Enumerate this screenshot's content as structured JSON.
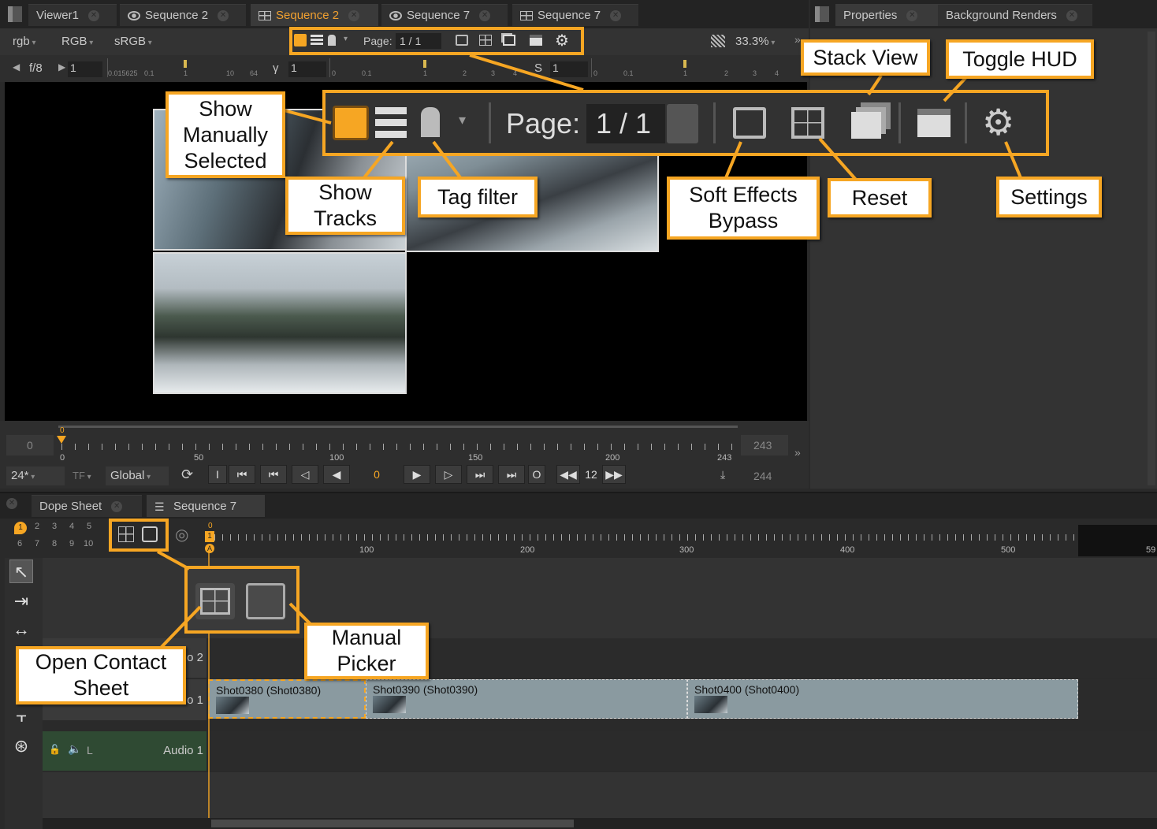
{
  "viewer_tabs": [
    {
      "label": "Viewer1",
      "icon": "",
      "active": false
    },
    {
      "label": "Sequence 2",
      "icon": "eye-icon",
      "active": false
    },
    {
      "label": "Sequence 2",
      "icon": "contact-sheet-icon",
      "active": true
    },
    {
      "label": "Sequence 7",
      "icon": "eye-icon",
      "active": false
    },
    {
      "label": "Sequence 7",
      "icon": "contact-sheet-icon",
      "active": false
    }
  ],
  "right_tabs": [
    {
      "label": "Properties"
    },
    {
      "label": "Background Renders"
    }
  ],
  "viewer_toolbar": {
    "channels": "rgb",
    "colorspace_a": "RGB",
    "colorspace_b": "sRGB",
    "page_label": "Page:",
    "page_value": "1 / 1",
    "zoom": "33.3%"
  },
  "exposure_bar": {
    "fstop": "f/8",
    "gain_value": "1",
    "gain_ticks": [
      "0.015625",
      "0.1",
      "1",
      "10",
      "64"
    ],
    "gamma_label": "γ",
    "gamma_value": "1",
    "gamma_ticks": [
      "0",
      "0.1",
      "1",
      "2",
      "3",
      "4"
    ],
    "sat_label": "S",
    "sat_value": "1",
    "sat_ticks": [
      "0",
      "0.1",
      "1",
      "2",
      "3",
      "4"
    ]
  },
  "callouts": {
    "show_manually_selected": "Show Manually Selected",
    "show_tracks": "Show Tracks",
    "tag_filter": "Tag filter",
    "stack_view": "Stack View",
    "toggle_hud": "Toggle HUD",
    "soft_effects_bypass": "Soft Effects Bypass",
    "reset": "Reset",
    "settings": "Settings",
    "open_contact_sheet": "Open Contact Sheet",
    "manual_picker": "Manual Picker"
  },
  "zoomed_toolbar": {
    "page_label": "Page:",
    "page_value": "1 / 1"
  },
  "timeline": {
    "start": "0",
    "in_marker": "0",
    "ticks": [
      "0",
      "50",
      "100",
      "150",
      "200",
      "243"
    ],
    "end_top": "243",
    "end_bottom": "244",
    "fps": "24*",
    "tf": "TF",
    "scope": "Global",
    "in_btn": "I",
    "out_btn": "O",
    "current_frame": "0",
    "step": "12"
  },
  "bottom_tabs": [
    {
      "label": "Dope Sheet"
    },
    {
      "label": "Sequence 7"
    }
  ],
  "layer_numbers_top": [
    "1",
    "2",
    "3",
    "4",
    "5"
  ],
  "layer_numbers_bottom": [
    "6",
    "7",
    "8",
    "9",
    "10"
  ],
  "seq_ruler": {
    "ticks": [
      "100",
      "200",
      "300",
      "400",
      "500",
      "59"
    ],
    "start": "0",
    "playhead": "1",
    "marker": "A"
  },
  "tracks": {
    "video2_label": "o 2",
    "video1_label": "o 1",
    "audio1_label": "Audio 1",
    "audio1_channel": "L",
    "clips": [
      {
        "name": "Shot0380 (Shot0380)"
      },
      {
        "name": "Shot0390 (Shot0390)"
      },
      {
        "name": "Shot0400 (Shot0400)"
      }
    ]
  },
  "colors": {
    "accent": "#f6a623",
    "panel": "#2a2a2a",
    "clip": "#8a9aa0"
  }
}
